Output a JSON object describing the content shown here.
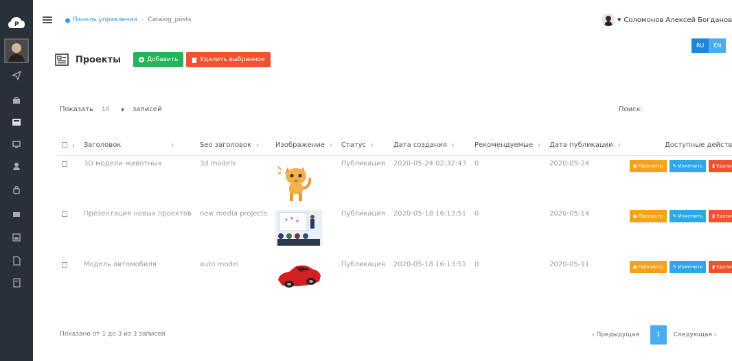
{
  "breadcrumb": {
    "home": "Панель управления",
    "current": "Catalog_posts"
  },
  "user": {
    "name": "Соломонов Алексей Богданов"
  },
  "lang": {
    "ru": "RU",
    "en": "EN"
  },
  "page": {
    "title": "Проекты",
    "add_label": "Добавить",
    "delete_selected_label": "Удалить выбранное"
  },
  "length": {
    "prefix": "Показать",
    "value": "10",
    "suffix": "записей"
  },
  "search": {
    "label": "Поиск:"
  },
  "table": {
    "headers": [
      "Заголовок",
      "Seo заголовок",
      "Изображение",
      "Статус",
      "Дата создания",
      "Рекомендуемые",
      "Дата публикации",
      "Доступные действия"
    ],
    "rows": [
      {
        "title": "3D модели животных",
        "seo": "3d models",
        "image": "cat-image",
        "status": "Публикация",
        "created": "2020-05-24 02:32:43",
        "recommended": "0",
        "published": "2020-05-24"
      },
      {
        "title": "Презентация новых проектов",
        "seo": "new media projects",
        "image": "presentation-image",
        "status": "Публикация",
        "created": "2020-05-18 16:13:51",
        "recommended": "0",
        "published": "2020-05-14"
      },
      {
        "title": "Модель автомобиля",
        "seo": "auto model",
        "image": "car-image",
        "status": "Публикация",
        "created": "2020-05-18 16:13:51",
        "recommended": "0",
        "published": "2020-05-11"
      }
    ],
    "actions": {
      "view": "Просмотр",
      "edit": "Изменить",
      "delete": "Удалить"
    }
  },
  "footer": {
    "info": "Показано от 1 до 3 из 3 записей"
  },
  "pagination": {
    "prev": "‹ Предыдущая",
    "page": "1",
    "next": "Следующая ›"
  },
  "colors": {
    "sidebar": "#2a3038",
    "add": "#25b45a",
    "delete": "#f0512e",
    "view": "#f5a11a",
    "edit": "#2ea7e8",
    "accent": "#4aaeee"
  }
}
